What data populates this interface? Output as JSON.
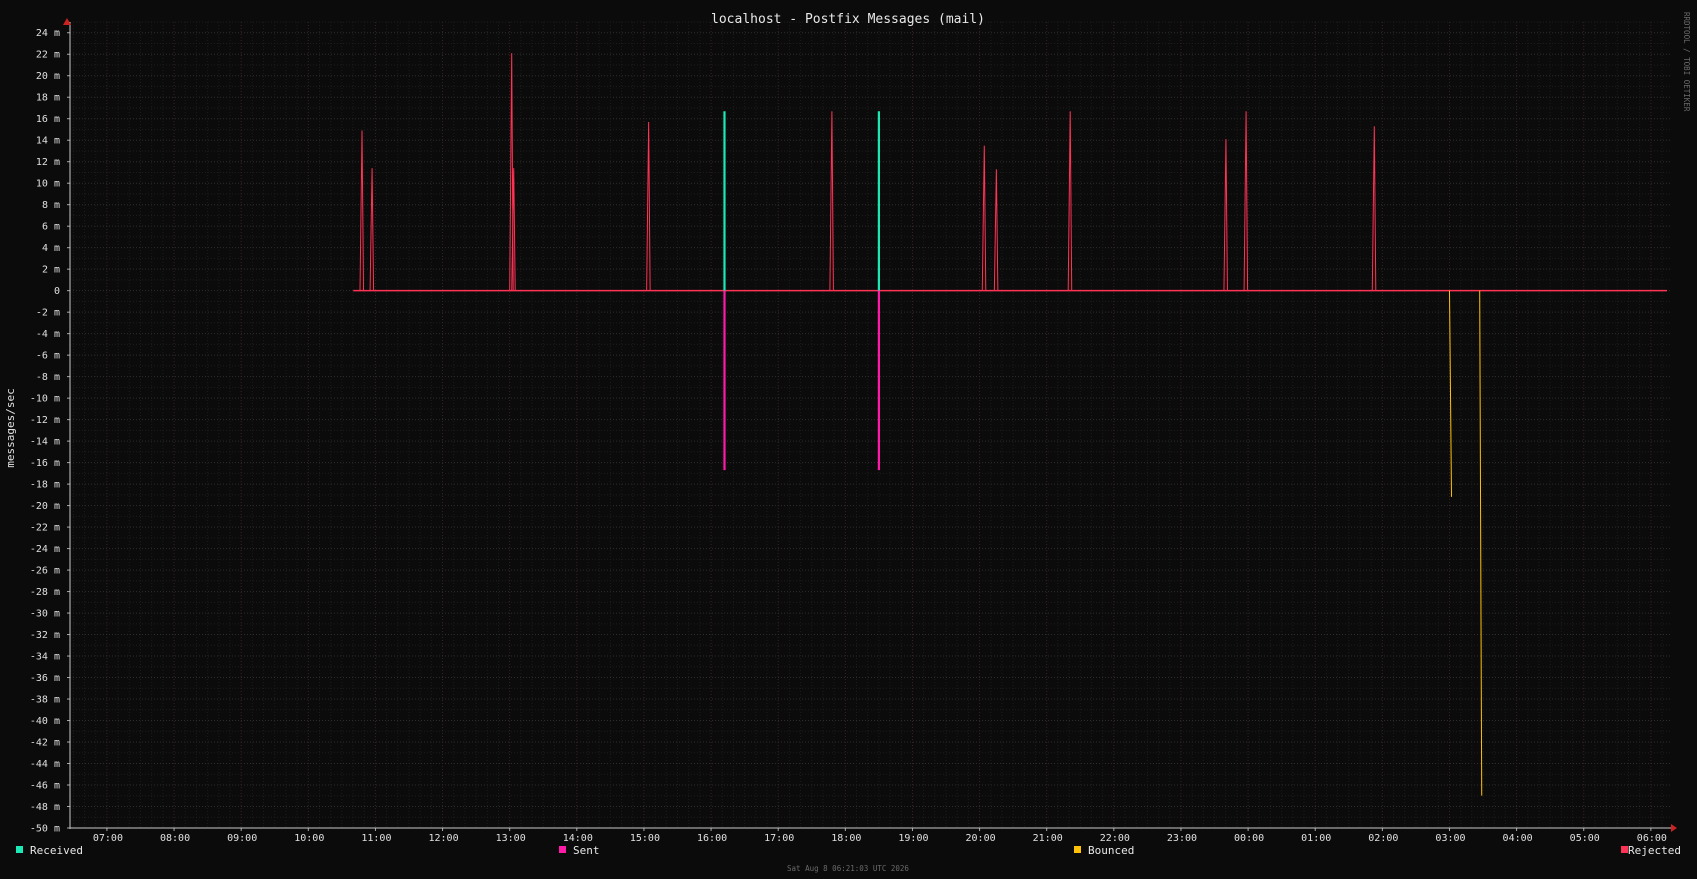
{
  "chart_data": {
    "type": "line",
    "title": "localhost - Postfix Messages (mail)",
    "ylabel": "messages/sec",
    "xlabel": "",
    "ylim": [
      -50,
      25
    ],
    "y_unit_suffix": "m",
    "y_ticks": [
      24,
      22,
      20,
      18,
      16,
      14,
      12,
      10,
      8,
      6,
      4,
      2,
      0,
      -2,
      -4,
      -6,
      -8,
      -10,
      -12,
      -14,
      -16,
      -18,
      -20,
      -22,
      -24,
      -26,
      -28,
      -30,
      -32,
      -34,
      -36,
      -38,
      -40,
      -42,
      -44,
      -46,
      -48,
      -50
    ],
    "y_tick_labels": [
      "24 m",
      "22 m",
      "20 m",
      "18 m",
      "16 m",
      "14 m",
      "12 m",
      "10 m",
      "8 m",
      "6 m",
      "4 m",
      "2 m",
      "0",
      "-2 m",
      "-4 m",
      "-6 m",
      "-8 m",
      "-10 m",
      "-12 m",
      "-14 m",
      "-16 m",
      "-18 m",
      "-20 m",
      "-22 m",
      "-24 m",
      "-26 m",
      "-28 m",
      "-30 m",
      "-32 m",
      "-34 m",
      "-36 m",
      "-38 m",
      "-40 m",
      "-42 m",
      "-44 m",
      "-46 m",
      "-48 m",
      "-50 m"
    ],
    "x_range_hours": [
      6.45,
      30.3
    ],
    "x_tick_labels": [
      "07:00",
      "08:00",
      "09:00",
      "10:00",
      "11:00",
      "12:00",
      "13:00",
      "14:00",
      "15:00",
      "16:00",
      "17:00",
      "18:00",
      "19:00",
      "20:00",
      "21:00",
      "22:00",
      "23:00",
      "00:00",
      "01:00",
      "02:00",
      "03:00",
      "04:00",
      "05:00",
      "06:00"
    ],
    "x_tick_hours": [
      7,
      8,
      9,
      10,
      11,
      12,
      13,
      14,
      15,
      16,
      17,
      18,
      19,
      20,
      21,
      22,
      23,
      24,
      25,
      26,
      27,
      28,
      29,
      30
    ],
    "grid": true,
    "legend_position": "bottom",
    "baseline_start_hour": 10.67,
    "series": [
      {
        "name": "Received",
        "color": "#1de9b6",
        "points": [
          [
            16.2,
            16.7
          ],
          [
            18.5,
            16.7
          ]
        ]
      },
      {
        "name": "Sent",
        "color": "#ff1aa8",
        "points": [
          [
            16.2,
            -16.7
          ],
          [
            18.5,
            -16.7
          ]
        ]
      },
      {
        "name": "Bounced",
        "color": "#ffc107",
        "points": [
          [
            27.03,
            -19
          ],
          [
            27.48,
            -46.8
          ]
        ]
      },
      {
        "name": "Rejected",
        "color": "#ff3355",
        "points": [
          [
            10.8,
            14.9
          ],
          [
            10.95,
            11.4
          ],
          [
            13.03,
            22.1
          ],
          [
            13.06,
            11.4
          ],
          [
            15.07,
            15.7
          ],
          [
            17.8,
            16.7
          ],
          [
            20.07,
            13.5
          ],
          [
            20.25,
            11.3
          ],
          [
            21.35,
            16.7
          ],
          [
            23.67,
            14.1
          ],
          [
            23.97,
            16.7
          ],
          [
            25.88,
            15.3
          ]
        ]
      }
    ],
    "footer": "Sat Aug  8 06:21:03 UTC 2026",
    "watermark": "RRDTOOL / TOBI OETIKER"
  }
}
